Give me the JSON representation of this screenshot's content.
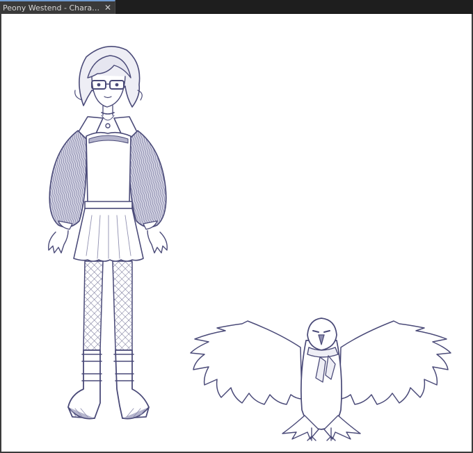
{
  "window": {
    "tab_title": "Peony Westend - Character Sheet",
    "close_glyph": "✕"
  },
  "colors": {
    "sketch_line": "#4a4a78",
    "sketch_light": "#8f8fb0",
    "sketch_fill": "#c9c9dc",
    "canvas_bg": "#ffffff",
    "ui_bg": "#2b2b2b",
    "tab_accent": "#6f9bd1"
  },
  "icons": {
    "tab_close": "close-icon"
  }
}
